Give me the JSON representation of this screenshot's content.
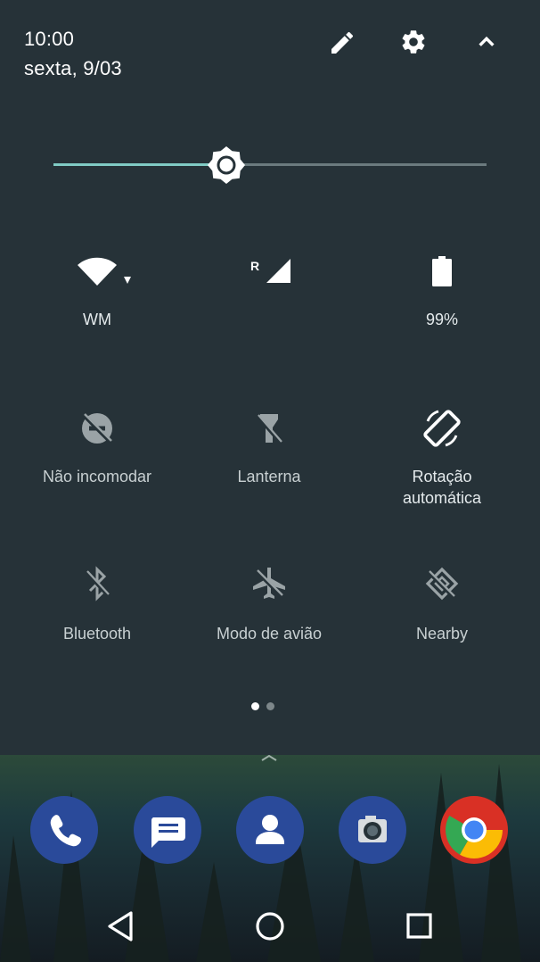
{
  "header": {
    "time": "10:00",
    "date": "sexta, 9/03",
    "edit_icon": "pencil-icon",
    "settings_icon": "gear-icon",
    "collapse_icon": "chevron-up-icon"
  },
  "brightness": {
    "level": 0.4,
    "icon": "brightness-icon"
  },
  "status_tiles": [
    {
      "icon": "wifi-icon",
      "label": "WM"
    },
    {
      "icon": "cell-signal-roaming-icon",
      "label": "",
      "roaming_badge": "R"
    },
    {
      "icon": "battery-icon",
      "label": "99%"
    }
  ],
  "toggles": [
    {
      "icon": "do-not-disturb-off-icon",
      "label": "Não incomodar",
      "active": false
    },
    {
      "icon": "flashlight-off-icon",
      "label": "Lanterna",
      "active": false
    },
    {
      "icon": "screen-rotation-icon",
      "label_line1": "Rotação",
      "label_line2": "automática",
      "active": true
    },
    {
      "icon": "bluetooth-off-icon",
      "label": "Bluetooth",
      "active": false
    },
    {
      "icon": "airplane-off-icon",
      "label": "Modo de avião",
      "active": false
    },
    {
      "icon": "nearby-off-icon",
      "label": "Nearby",
      "active": false
    }
  ],
  "pager": {
    "pages": 2,
    "current": 1
  },
  "dock": [
    {
      "icon": "phone-icon"
    },
    {
      "icon": "messages-icon"
    },
    {
      "icon": "contacts-icon"
    },
    {
      "icon": "camera-icon"
    },
    {
      "icon": "chrome-icon"
    }
  ],
  "nav": {
    "back": "back-icon",
    "home": "home-icon",
    "recents": "recents-icon"
  },
  "colors": {
    "shade_bg": "#263238",
    "accent": "#80cbc4",
    "icon_active": "#ffffff",
    "icon_inactive": "#9aa3a6"
  }
}
